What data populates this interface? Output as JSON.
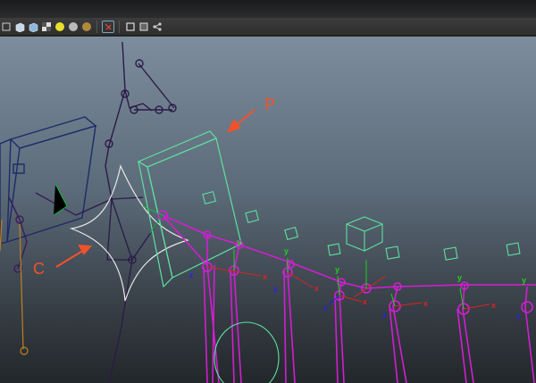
{
  "toolbar": {
    "icons": [
      "wireframe-cube-icon",
      "shaded-cube-icon",
      "textured-cube-icon",
      "lit-sphere-icon",
      "light-sphere-icon",
      "shadow-sphere-icon",
      "isolate-select-icon",
      "xray-cube-icon",
      "xray-joints-icon",
      "share-icon"
    ]
  },
  "annotations": {
    "p_label": "P",
    "c_label": "C"
  },
  "colors": {
    "viewport_top": "#7d8d9d",
    "viewport_bottom": "#23272b",
    "joint_magenta": "#d21ed2",
    "control_green": "#5ee0a0",
    "skeleton_purple": "#3a1f5a",
    "annotation_orange": "#f2522a",
    "curve_white": "#e8e8e8"
  },
  "axis_labels": {
    "x": "x",
    "y": "y",
    "z": "z"
  }
}
